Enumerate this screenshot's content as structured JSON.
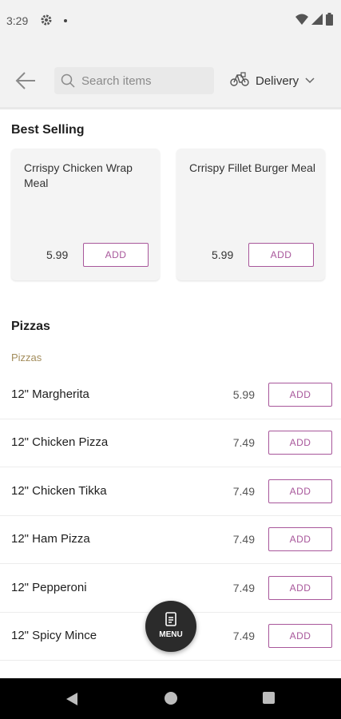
{
  "status_bar": {
    "time": "3:29"
  },
  "search": {
    "placeholder": "Search items"
  },
  "delivery": {
    "label": "Delivery"
  },
  "best_selling": {
    "title": "Best Selling",
    "items": [
      {
        "name": "Crrispy Chicken Wrap Meal",
        "price": "5.99",
        "add_label": "ADD"
      },
      {
        "name": "Crrispy Fillet Burger Meal",
        "price": "5.99",
        "add_label": "ADD"
      }
    ]
  },
  "pizzas": {
    "title": "Pizzas",
    "subcategory": "Pizzas",
    "items": [
      {
        "name": "12\" Margherita",
        "price": "5.99",
        "add_label": "ADD"
      },
      {
        "name": "12\" Chicken Pizza",
        "price": "7.49",
        "add_label": "ADD"
      },
      {
        "name": "12\" Chicken Tikka",
        "price": "7.49",
        "add_label": "ADD"
      },
      {
        "name": "12\" Ham Pizza",
        "price": "7.49",
        "add_label": "ADD"
      },
      {
        "name": "12\" Pepperoni",
        "price": "7.49",
        "add_label": "ADD"
      },
      {
        "name": "12\" Spicy Mince",
        "price": "7.49",
        "add_label": "ADD"
      }
    ]
  },
  "menu_fab": {
    "label": "MENU"
  },
  "colors": {
    "accent": "#a8579b",
    "subcategory": "#a38d5c",
    "fab": "#2b2b2b"
  }
}
